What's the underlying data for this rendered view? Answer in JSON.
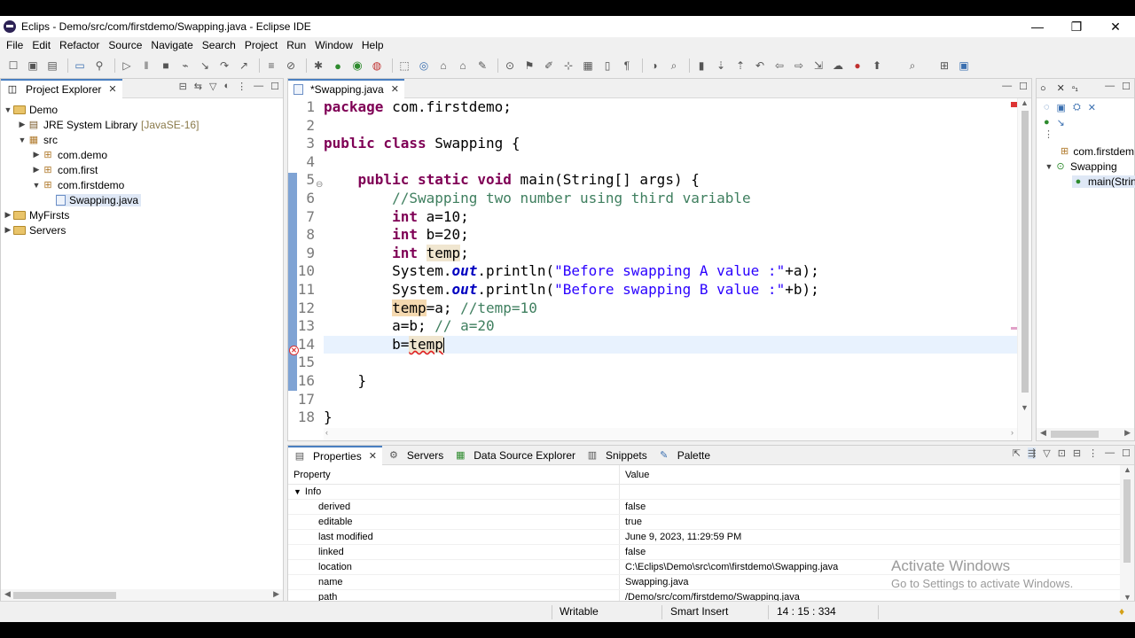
{
  "window": {
    "title": "Eclips - Demo/src/com/firstdemo/Swapping.java - Eclipse IDE",
    "minimize": "—",
    "maximize": "❐",
    "close": "✕"
  },
  "menu": [
    "File",
    "Edit",
    "Refactor",
    "Source",
    "Navigate",
    "Search",
    "Project",
    "Run",
    "Window",
    "Help"
  ],
  "project_explorer": {
    "tab_label": "Project Explorer",
    "tree": [
      {
        "level": 0,
        "twisty": "open",
        "icon": "project-icon",
        "label": "Demo"
      },
      {
        "level": 1,
        "twisty": "closed",
        "icon": "library-icon",
        "label": "JRE System Library",
        "note": "[JavaSE-16]"
      },
      {
        "level": 1,
        "twisty": "open",
        "icon": "source-folder-icon",
        "label": "src"
      },
      {
        "level": 2,
        "twisty": "closed",
        "icon": "package-icon",
        "label": "com.demo"
      },
      {
        "level": 2,
        "twisty": "closed",
        "icon": "package-icon",
        "label": "com.first"
      },
      {
        "level": 2,
        "twisty": "open",
        "icon": "package-icon",
        "label": "com.firstdemo"
      },
      {
        "level": 3,
        "twisty": "none",
        "icon": "java-file-icon",
        "label": "Swapping.java",
        "selected": true
      },
      {
        "level": 0,
        "twisty": "closed",
        "icon": "project-icon",
        "label": "MyFirsts"
      },
      {
        "level": 0,
        "twisty": "closed",
        "icon": "project-icon",
        "label": "Servers"
      }
    ]
  },
  "editor": {
    "tab_label": "*Swapping.java",
    "line_numbers": [
      "1",
      "2",
      "3",
      "4",
      "5",
      "6",
      "7",
      "8",
      "9",
      "10",
      "11",
      "12",
      "13",
      "14",
      "15",
      "16",
      "17",
      "18"
    ],
    "code": {
      "l1_kw": "package",
      "l1_rest": " com.firstdemo;",
      "l3_kw": "public class",
      "l3_rest": " Swapping {",
      "l5_indent": "    ",
      "l5_kw": "public static void",
      "l5_rest": " main(String[] args) {",
      "l6_indent": "        ",
      "l6_cm": "//Swapping two number using third variable",
      "l7_indent": "        ",
      "l7_kw": "int",
      "l7_rest": " a=10;",
      "l8_indent": "        ",
      "l8_kw": "int",
      "l8_rest": " b=20;",
      "l9_indent": "        ",
      "l9_kw": "int",
      "l9_sp": " ",
      "l9_var": "temp",
      "l9_end": ";",
      "l10_indent": "        ",
      "l10_a": "System.",
      "l10_fld": "out",
      "l10_b": ".println(",
      "l10_str": "\"Before swapping A value :\"",
      "l10_c": "+a);",
      "l11_indent": "        ",
      "l11_a": "System.",
      "l11_fld": "out",
      "l11_b": ".println(",
      "l11_str": "\"Before swapping B value :\"",
      "l11_c": "+b);",
      "l12_indent": "        ",
      "l12_var": "temp",
      "l12_rest": "=a; ",
      "l12_cm": "//temp=10",
      "l13_indent": "        ",
      "l13_rest": "a=b; ",
      "l13_cm": "// a=20",
      "l14_indent": "        ",
      "l14_rest": "b=",
      "l14_var": "temp",
      "l16_indent": "    ",
      "l16_rest": "}",
      "l18_rest": "}"
    }
  },
  "outline": {
    "items": [
      {
        "label": "com.firstdem",
        "icon": "package-icon"
      },
      {
        "label": "Swapping",
        "icon": "class-icon"
      },
      {
        "label": "main(Strin",
        "icon": "method-icon"
      }
    ]
  },
  "bottom_panel": {
    "tabs": [
      "Properties",
      "Servers",
      "Data Source Explorer",
      "Snippets",
      "Palette"
    ],
    "header_property": "Property",
    "header_value": "Value",
    "group": "Info",
    "rows": [
      {
        "k": "derived",
        "v": "false"
      },
      {
        "k": "editable",
        "v": "true"
      },
      {
        "k": "last modified",
        "v": "June 9, 2023, 11:29:59 PM"
      },
      {
        "k": "linked",
        "v": "false"
      },
      {
        "k": "location",
        "v": "C:\\Eclips\\Demo\\src\\com\\firstdemo\\Swapping.java"
      },
      {
        "k": "name",
        "v": "Swapping.java"
      },
      {
        "k": "path",
        "v": "/Demo/src/com/firstdemo/Swapping.java"
      }
    ]
  },
  "status": {
    "writable": "Writable",
    "insert_mode": "Smart Insert",
    "position": "14 : 15 : 334"
  },
  "watermark": {
    "line1": "Activate Windows",
    "line2": "Go to Settings to activate Windows."
  }
}
